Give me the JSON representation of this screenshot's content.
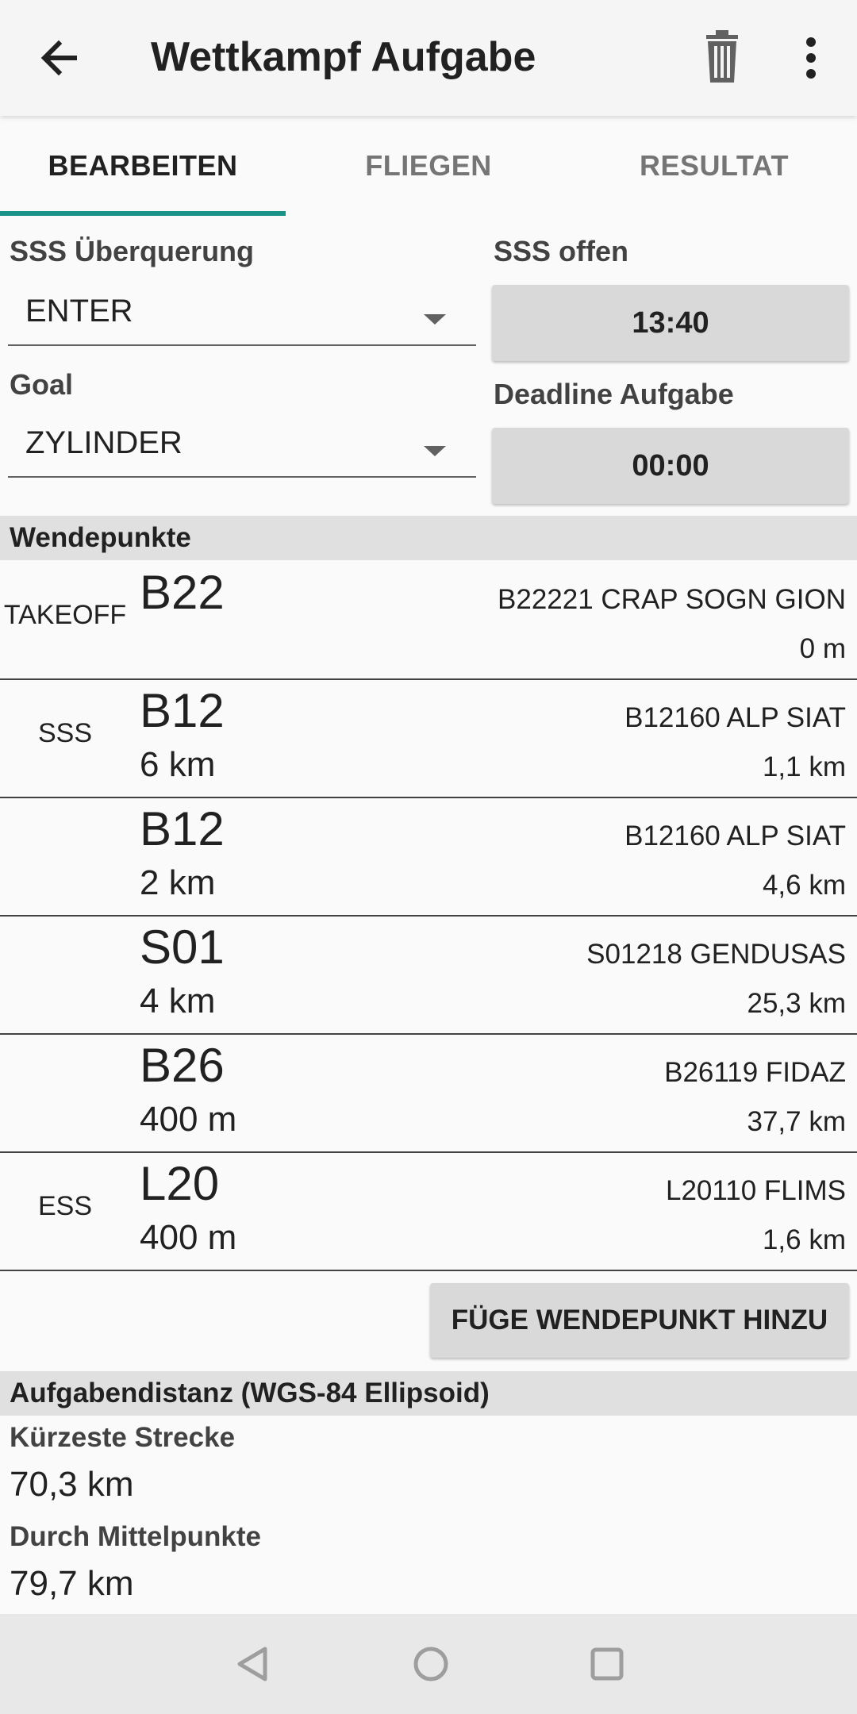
{
  "app_bar": {
    "title": "Wettkampf Aufgabe"
  },
  "tabs": [
    {
      "label": "BEARBEITEN"
    },
    {
      "label": "FLIEGEN"
    },
    {
      "label": "RESULTAT"
    }
  ],
  "form": {
    "sss_crossing": {
      "label": "SSS Überquerung",
      "value": "ENTER"
    },
    "goal": {
      "label": "Goal",
      "value": "ZYLINDER"
    },
    "sss_open": {
      "label": "SSS offen",
      "value": "13:40"
    },
    "deadline": {
      "label": "Deadline Aufgabe",
      "value": "00:00"
    }
  },
  "turnpoints": {
    "header": "Wendepunkte",
    "items": [
      {
        "type": "TAKEOFF",
        "name": "B22",
        "radius": "",
        "description": "B22221 CRAP SOGN GION",
        "distance": "0 m"
      },
      {
        "type": "SSS",
        "name": "B12",
        "radius": "6 km",
        "description": "B12160 ALP SIAT",
        "distance": "1,1 km"
      },
      {
        "type": "",
        "name": "B12",
        "radius": "2 km",
        "description": "B12160 ALP SIAT",
        "distance": "4,6 km"
      },
      {
        "type": "",
        "name": "S01",
        "radius": "4 km",
        "description": "S01218 GENDUSAS",
        "distance": "25,3 km"
      },
      {
        "type": "",
        "name": "B26",
        "radius": "400 m",
        "description": "B26119 FIDAZ",
        "distance": "37,7 km"
      },
      {
        "type": "ESS",
        "name": "L20",
        "radius": "400 m",
        "description": "L20110 FLIMS",
        "distance": "1,6 km"
      }
    ],
    "add_button": "FÜGE WENDEPUNKT HINZU"
  },
  "task_distance": {
    "header": "Aufgabendistanz (WGS-84 Ellipsoid)",
    "shortest_label": "Kürzeste Strecke",
    "shortest_value": "70,3 km",
    "center_label": "Durch Mittelpunkte",
    "center_value": "79,7 km"
  },
  "icons": {
    "back": "arrow-left-icon",
    "delete": "trash-icon",
    "more": "more-vert-icon",
    "nav_back": "nav-back-icon",
    "nav_home": "nav-home-icon",
    "nav_recent": "nav-recent-icon"
  },
  "colors": {
    "accent": "#1a9488"
  }
}
